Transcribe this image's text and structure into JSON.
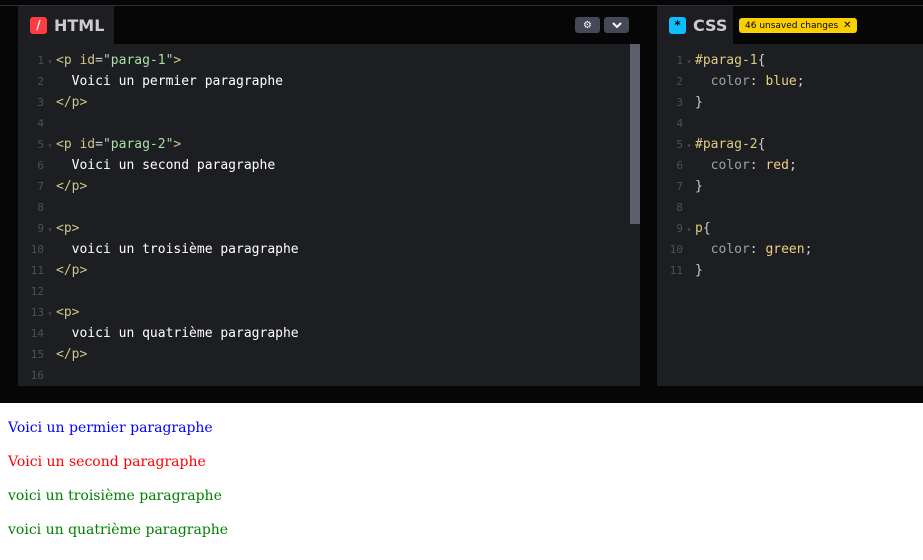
{
  "html_panel": {
    "title": "HTML",
    "icon": "slash-icon",
    "settings_icon": "gear-icon",
    "collapse_icon": "chevron-down-icon",
    "lines": [
      {
        "n": "1",
        "fold": true,
        "parts": [
          [
            "tag",
            "<p "
          ],
          [
            "attr",
            "id"
          ],
          [
            "punc",
            "="
          ],
          [
            "str",
            "\"parag-1\""
          ],
          [
            "tag",
            ">"
          ]
        ]
      },
      {
        "n": "2",
        "fold": false,
        "parts": [
          [
            "txt",
            "  Voici un permier paragraphe"
          ]
        ]
      },
      {
        "n": "3",
        "fold": false,
        "parts": [
          [
            "tag",
            "</p>"
          ]
        ]
      },
      {
        "n": "4",
        "fold": false,
        "parts": []
      },
      {
        "n": "5",
        "fold": true,
        "parts": [
          [
            "tag",
            "<p "
          ],
          [
            "attr",
            "id"
          ],
          [
            "punc",
            "="
          ],
          [
            "str",
            "\"parag-2\""
          ],
          [
            "tag",
            ">"
          ]
        ]
      },
      {
        "n": "6",
        "fold": false,
        "parts": [
          [
            "txt",
            "  Voici un second paragraphe"
          ]
        ]
      },
      {
        "n": "7",
        "fold": false,
        "parts": [
          [
            "tag",
            "</p>"
          ]
        ]
      },
      {
        "n": "8",
        "fold": false,
        "parts": []
      },
      {
        "n": "9",
        "fold": true,
        "parts": [
          [
            "tag",
            "<p>"
          ]
        ]
      },
      {
        "n": "10",
        "fold": false,
        "parts": [
          [
            "txt",
            "  voici un troisième paragraphe"
          ]
        ]
      },
      {
        "n": "11",
        "fold": false,
        "parts": [
          [
            "tag",
            "</p>"
          ]
        ]
      },
      {
        "n": "12",
        "fold": false,
        "parts": []
      },
      {
        "n": "13",
        "fold": true,
        "parts": [
          [
            "tag",
            "<p>"
          ]
        ]
      },
      {
        "n": "14",
        "fold": false,
        "parts": [
          [
            "txt",
            "  voici un quatrième paragraphe"
          ]
        ]
      },
      {
        "n": "15",
        "fold": false,
        "parts": [
          [
            "tag",
            "</p>"
          ]
        ]
      },
      {
        "n": "16",
        "fold": false,
        "parts": []
      }
    ]
  },
  "css_panel": {
    "title": "CSS",
    "icon": "asterisk-icon",
    "unsaved_label": "46 unsaved changes",
    "unsaved_close": "✕",
    "lines": [
      {
        "n": "1",
        "fold": true,
        "parts": [
          [
            "sel",
            "#parag-1"
          ],
          [
            "punc",
            "{"
          ]
        ]
      },
      {
        "n": "2",
        "fold": false,
        "parts": [
          [
            "prop",
            "  color"
          ],
          [
            "punc",
            ": "
          ],
          [
            "val",
            "blue"
          ],
          [
            "punc",
            ";"
          ]
        ]
      },
      {
        "n": "3",
        "fold": false,
        "parts": [
          [
            "punc",
            "}"
          ]
        ]
      },
      {
        "n": "4",
        "fold": false,
        "parts": []
      },
      {
        "n": "5",
        "fold": true,
        "parts": [
          [
            "sel",
            "#parag-2"
          ],
          [
            "punc",
            "{"
          ]
        ]
      },
      {
        "n": "6",
        "fold": false,
        "parts": [
          [
            "prop",
            "  color"
          ],
          [
            "punc",
            ": "
          ],
          [
            "val",
            "red"
          ],
          [
            "punc",
            ";"
          ]
        ]
      },
      {
        "n": "7",
        "fold": false,
        "parts": [
          [
            "punc",
            "}"
          ]
        ]
      },
      {
        "n": "8",
        "fold": false,
        "parts": []
      },
      {
        "n": "9",
        "fold": true,
        "parts": [
          [
            "sel",
            "p"
          ],
          [
            "punc",
            "{"
          ]
        ]
      },
      {
        "n": "10",
        "fold": false,
        "parts": [
          [
            "prop",
            "  color"
          ],
          [
            "punc",
            ": "
          ],
          [
            "val",
            "green"
          ],
          [
            "punc",
            ";"
          ]
        ]
      },
      {
        "n": "11",
        "fold": false,
        "parts": [
          [
            "punc",
            "}"
          ]
        ]
      }
    ]
  },
  "preview": {
    "paragraphs": [
      {
        "text": "Voici un permier paragraphe",
        "color": "#0000ff"
      },
      {
        "text": "Voici un second paragraphe",
        "color": "#ff0000"
      },
      {
        "text": "voici un troisième paragraphe",
        "color": "#008000"
      },
      {
        "text": "voici un quatrième paragraphe",
        "color": "#008000"
      }
    ]
  }
}
